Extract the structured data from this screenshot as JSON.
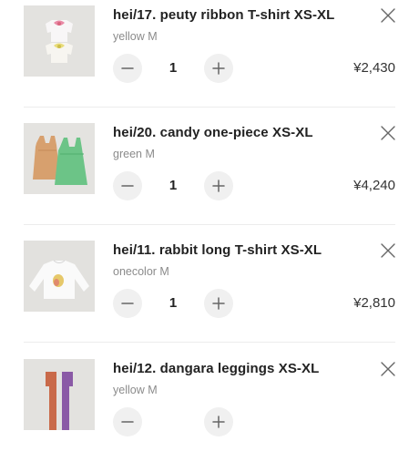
{
  "cart": {
    "items": [
      {
        "name": "hei/17. peuty ribbon T-shirt XS-XL",
        "variant": "yellow M",
        "quantity": "1",
        "price": "¥2,430",
        "thumb_icon": "two-ribbon-tshirts-photo"
      },
      {
        "name": "hei/20. candy one-piece XS-XL",
        "variant": "green M",
        "quantity": "1",
        "price": "¥4,240",
        "thumb_icon": "two-pinafore-dresses-photo"
      },
      {
        "name": "hei/11. rabbit long T-shirt XS-XL",
        "variant": "onecolor M",
        "quantity": "1",
        "price": "¥2,810",
        "thumb_icon": "white-long-sleeve-tshirt-photo"
      },
      {
        "name": "hei/12. dangara leggings XS-XL",
        "variant": "yellow M",
        "quantity": "",
        "price": "",
        "thumb_icon": "two-striped-leggings-photo"
      }
    ],
    "icons": {
      "remove": "close-icon",
      "decrease": "minus-icon",
      "increase": "plus-icon"
    },
    "colors": {
      "text": "#222222",
      "muted": "#8b8b8b",
      "button_bg": "#f0f0f0",
      "divider": "#ececec"
    }
  }
}
